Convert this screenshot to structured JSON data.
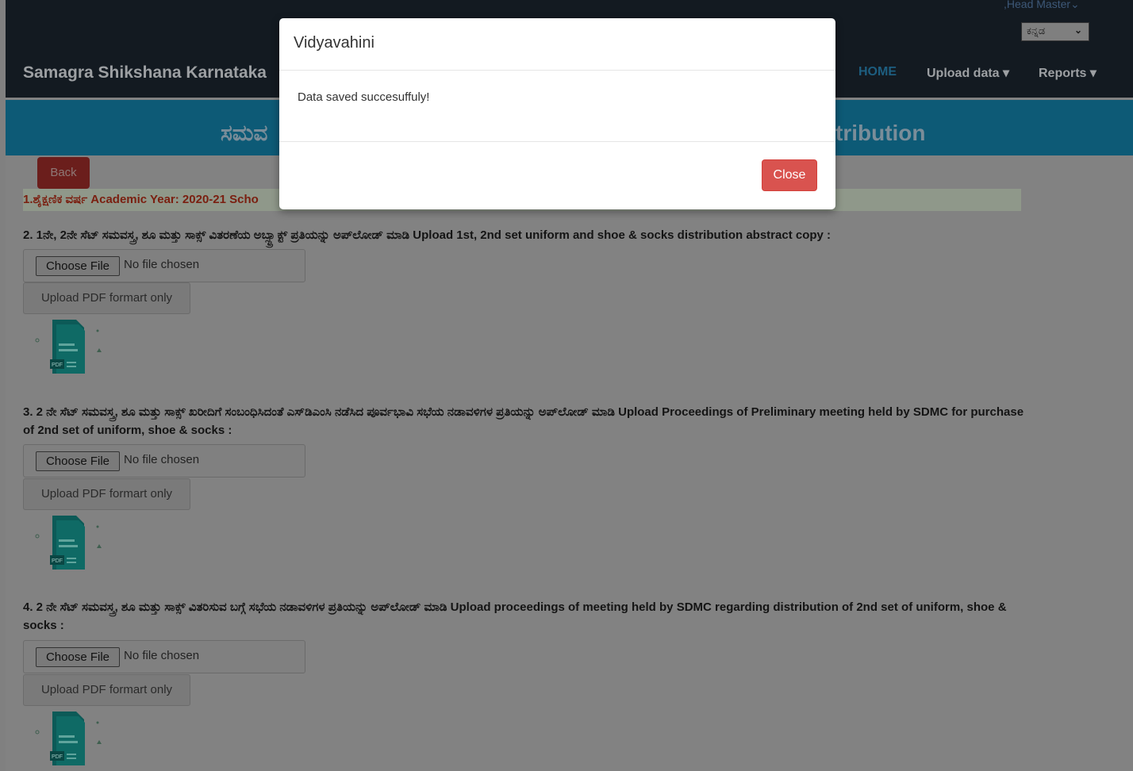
{
  "navbar": {
    "brand": "Samagra Shikshana Karnataka",
    "user_menu": ",Head Master",
    "language": "ಕನ್ನಡ",
    "links": {
      "home": "HOME",
      "upload": "Upload data ▾",
      "reports": "Reports ▾"
    }
  },
  "banner": {
    "left_text": "ಸಮವ",
    "right_text": "tribution"
  },
  "back_label": "Back",
  "year_text": "1.ಶೈಕ್ಷಣಿಕ ವರ್ಷ Academic Year: 2020-21 Scho",
  "sections": [
    {
      "question": "2. 1ನೇ, 2ನೇ ಸೆಟ್ ಸಮವಸ್ತ್ರ, ಶೂ ಮತ್ತು ಸಾಕ್ಸ್ ವಿತರಣೆಯ ಅಬ್ಸ್ಟ್ರಾಕ್ಟ್ ಪ್ರತಿಯನ್ನು ಅಪ್‌ಲೋಡ್ ಮಾಡಿ Upload 1st, 2nd set uniform and shoe & socks distribution abstract copy :",
      "choose_label": "Choose File",
      "no_file": "No file chosen",
      "pdf_label": "Upload PDF formart only"
    },
    {
      "question": "3. 2 ನೇ ಸೆಟ್ ಸಮವಸ್ತ್ರ, ಶೂ ಮತ್ತು ಸಾಕ್ಸ್ ಖರೀದಿಗೆ ಸಂಬಂಧಿಸಿದಂತೆ ಎಸ್‌ಡಿಎಂಸಿ ನಡೆಸಿದ ಪೂರ್ವಭಾವಿ ಸಭೆಯ ನಡಾವಳಿಗಳ ಪ್ರತಿಯನ್ನು ಅಪ್‌ಲೋಡ್ ಮಾಡಿ Upload Proceedings of Preliminary meeting held by SDMC for purchase of 2nd set of uniform, shoe & socks :",
      "choose_label": "Choose File",
      "no_file": "No file chosen",
      "pdf_label": "Upload PDF formart only"
    },
    {
      "question": "4. 2 ನೇ ಸೆಟ್ ಸಮವಸ್ತ್ರ, ಶೂ ಮತ್ತು ಸಾಕ್ಸ್ ವಿತರಿಸುವ ಬಗ್ಗೆ ಸಭೆಯ ನಡಾವಳಿಗಳ ಪ್ರತಿಯನ್ನು ಅಪ್‌ಲೋಡ್ ಮಾಡಿ Upload proceedings of meeting held by SDMC regarding distribution of 2nd set of uniform, shoe & socks :",
      "choose_label": "Choose File",
      "no_file": "No file chosen",
      "pdf_label": "Upload PDF formart only"
    }
  ],
  "modal": {
    "title": "Vidyavahini",
    "message": "Data saved succesuffuly!",
    "close_label": "Close"
  }
}
